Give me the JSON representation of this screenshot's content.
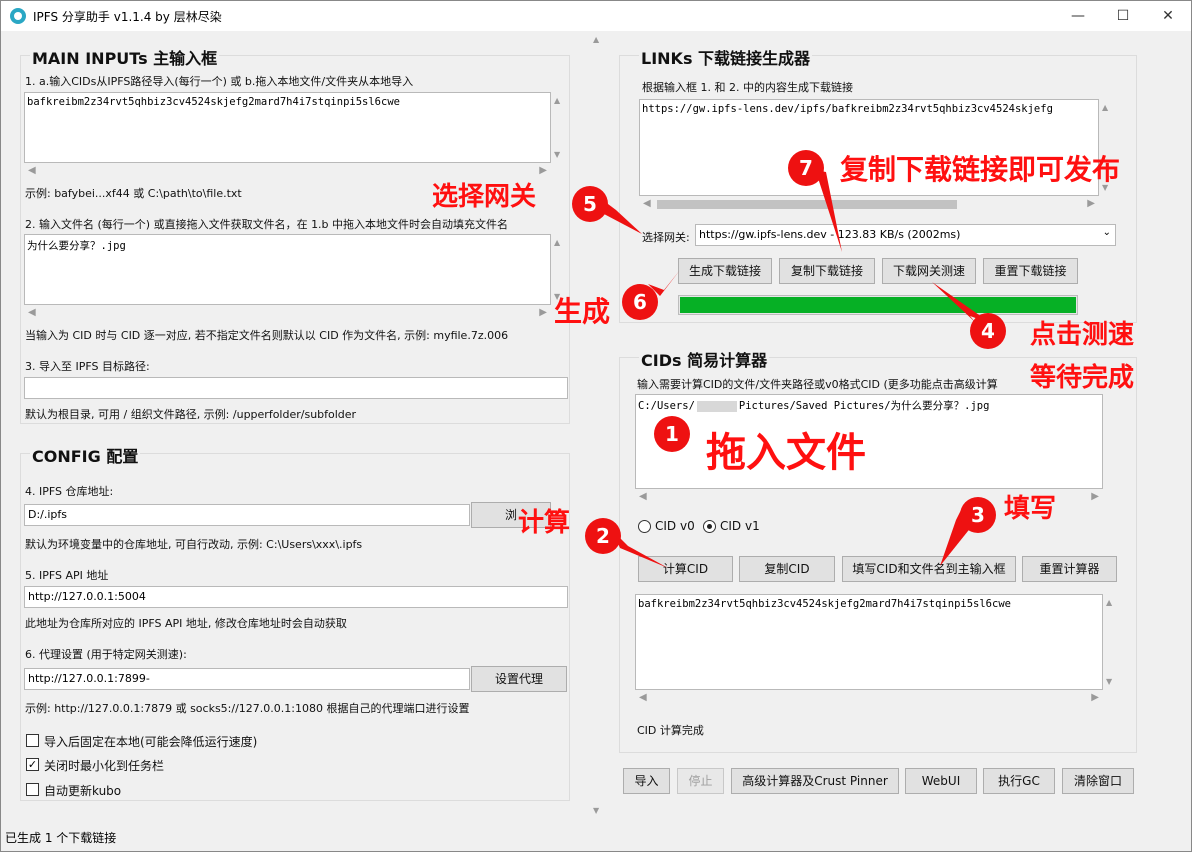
{
  "window": {
    "title": "IPFS 分享助手 v1.1.4 by 层林尽染",
    "minimize": "—",
    "maximize": "☐",
    "close": "✕"
  },
  "main_inputs": {
    "title": "MAIN INPUTs 主输入框",
    "cid_label": "1. a.输入CIDs从IPFS路径导入(每行一个)     或 b.拖入本地文件/文件夹从本地导入",
    "cid_value": "bafkreibm2z34rvt5qhbiz3cv4524skjefg2mard7h4i7stqinpi5sl6cwe",
    "cid_example": "示例: bafybei...xf44 或 C:\\path\\to\\file.txt",
    "filename_label": "2. 输入文件名 (每行一个)     或直接拖入文件获取文件名，在 1.b 中拖入本地文件时会自动填充文件名",
    "filename_value": "为什么要分享？.jpg",
    "filename_hint": "当输入为 CID 时与 CID 逐一对应, 若不指定文件名则默认以 CID 作为文件名, 示例: myfile.7z.006",
    "target_label": "3. 导入至 IPFS 目标路径:",
    "target_value": "",
    "target_hint": "默认为根目录, 可用 / 组织文件路径, 示例: /upperfolder/subfolder"
  },
  "config": {
    "title": "CONFIG 配置",
    "repo_label": "4. IPFS 仓库地址:",
    "repo_value": "D:/.ipfs",
    "browse_button": "浏",
    "repo_hint": "默认为环境变量中的仓库地址, 可自行改动, 示例: C:\\Users\\xxx\\.ipfs",
    "api_label": "5. IPFS API 地址",
    "api_value": "http://127.0.0.1:5004",
    "api_hint": "此地址为仓库所对应的 IPFS API 地址, 修改仓库地址时会自动获取",
    "proxy_label": "6. 代理设置 (用于特定网关测速):",
    "proxy_value": "http://127.0.0.1:7899-",
    "proxy_button": "设置代理",
    "proxy_hint": "示例: http://127.0.0.1:7879 或 socks5://127.0.0.1:1080 根据自己的代理端口进行设置",
    "options": [
      {
        "label": "导入后固定在本地(可能会降低运行速度)",
        "checked": false
      },
      {
        "label": "关闭时最小化到任务栏",
        "checked": true
      },
      {
        "label": "自动更新kubo",
        "checked": false
      }
    ]
  },
  "links": {
    "title": "LINKs 下载链接生成器",
    "desc": "根据输入框 1. 和 2. 中的内容生成下载链接",
    "output": "https://gw.ipfs-lens.dev/ipfs/bafkreibm2z34rvt5qhbiz3cv4524skjefg",
    "gateway_label": "选择网关:",
    "gateway_value": "https://gw.ipfs-lens.dev - 123.83 KB/s (2002ms)",
    "buttons": {
      "generate": "生成下载链接",
      "copy": "复制下载链接",
      "speedtest": "下载网关测速",
      "reset": "重置下载链接"
    },
    "progress": 1.0
  },
  "cid_calc": {
    "title": "CIDs 简易计算器",
    "desc": "输入需要计算CID的文件/文件夹路径或v0格式CID (更多功能点击高级计算",
    "path_prefix": "C:/Users/",
    "path_suffix": "Pictures/Saved Pictures/为什么要分享？.jpg",
    "cid_v0": "CID v0",
    "cid_v1": "CID v1",
    "selected": "v1",
    "buttons": {
      "calc": "计算CID",
      "copy": "复制CID",
      "fill": "填写CID和文件名到主输入框",
      "reset": "重置计算器"
    },
    "result": "bafkreibm2z34rvt5qhbiz3cv4524skjefg2mard7h4i7stqinpi5sl6cwe",
    "status": "CID 计算完成"
  },
  "bottom_buttons": {
    "import": "导入",
    "stop": "停止",
    "advanced": "高级计算器及Crust Pinner",
    "webui": "WebUI",
    "gc": "执行GC",
    "clear": "清除窗口"
  },
  "status_bar": "已生成 1 个下载链接",
  "annotations": {
    "m1": "1",
    "t1": "拖入文件",
    "m2": "2",
    "t2": "计算",
    "m3": "3",
    "t3": "填写",
    "m4": "4",
    "t4a": "点击测速",
    "t4b": "等待完成",
    "m5": "5",
    "t5": "选择网关",
    "m6": "6",
    "t6": "生成",
    "m7": "7",
    "t7": "复制下载链接即可发布"
  },
  "colors": {
    "annotation_red": "#ff1010",
    "progress_green": "#06b025"
  }
}
